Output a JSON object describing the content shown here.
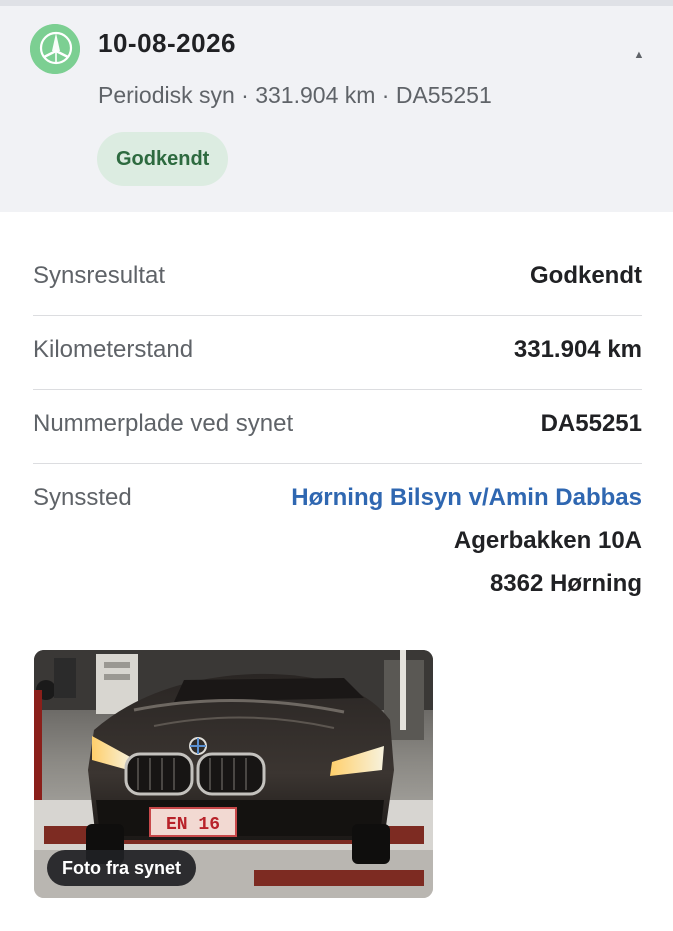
{
  "inspection": {
    "date": "10-08-2026",
    "summary": "Periodisk syn · 331.904 km · DA55251",
    "badge": "Godkendt",
    "logo_icon": "inspection-logo-icon",
    "collapse_icon": "chevron-up-icon"
  },
  "details": [
    {
      "label": "Synsresultat",
      "value": "Godkendt"
    },
    {
      "label": "Kilometerstand",
      "value": "331.904 km"
    },
    {
      "label": "Nummerplade ved synet",
      "value": "DA55251"
    }
  ],
  "place": {
    "label": "Synssted",
    "name": "Hørning Bilsyn v/Amin Dabbas",
    "address_line1": "Agerbakken 10A",
    "address_line2": "8362 Hørning"
  },
  "photo": {
    "caption": "Foto fra synet",
    "plate_text": "EN 16"
  },
  "colors": {
    "header_bg": "#f1f2f5",
    "badge_bg": "#dcece1",
    "badge_text": "#2d6a3f",
    "link": "#2f67b1",
    "logo": "#7ccf92"
  }
}
